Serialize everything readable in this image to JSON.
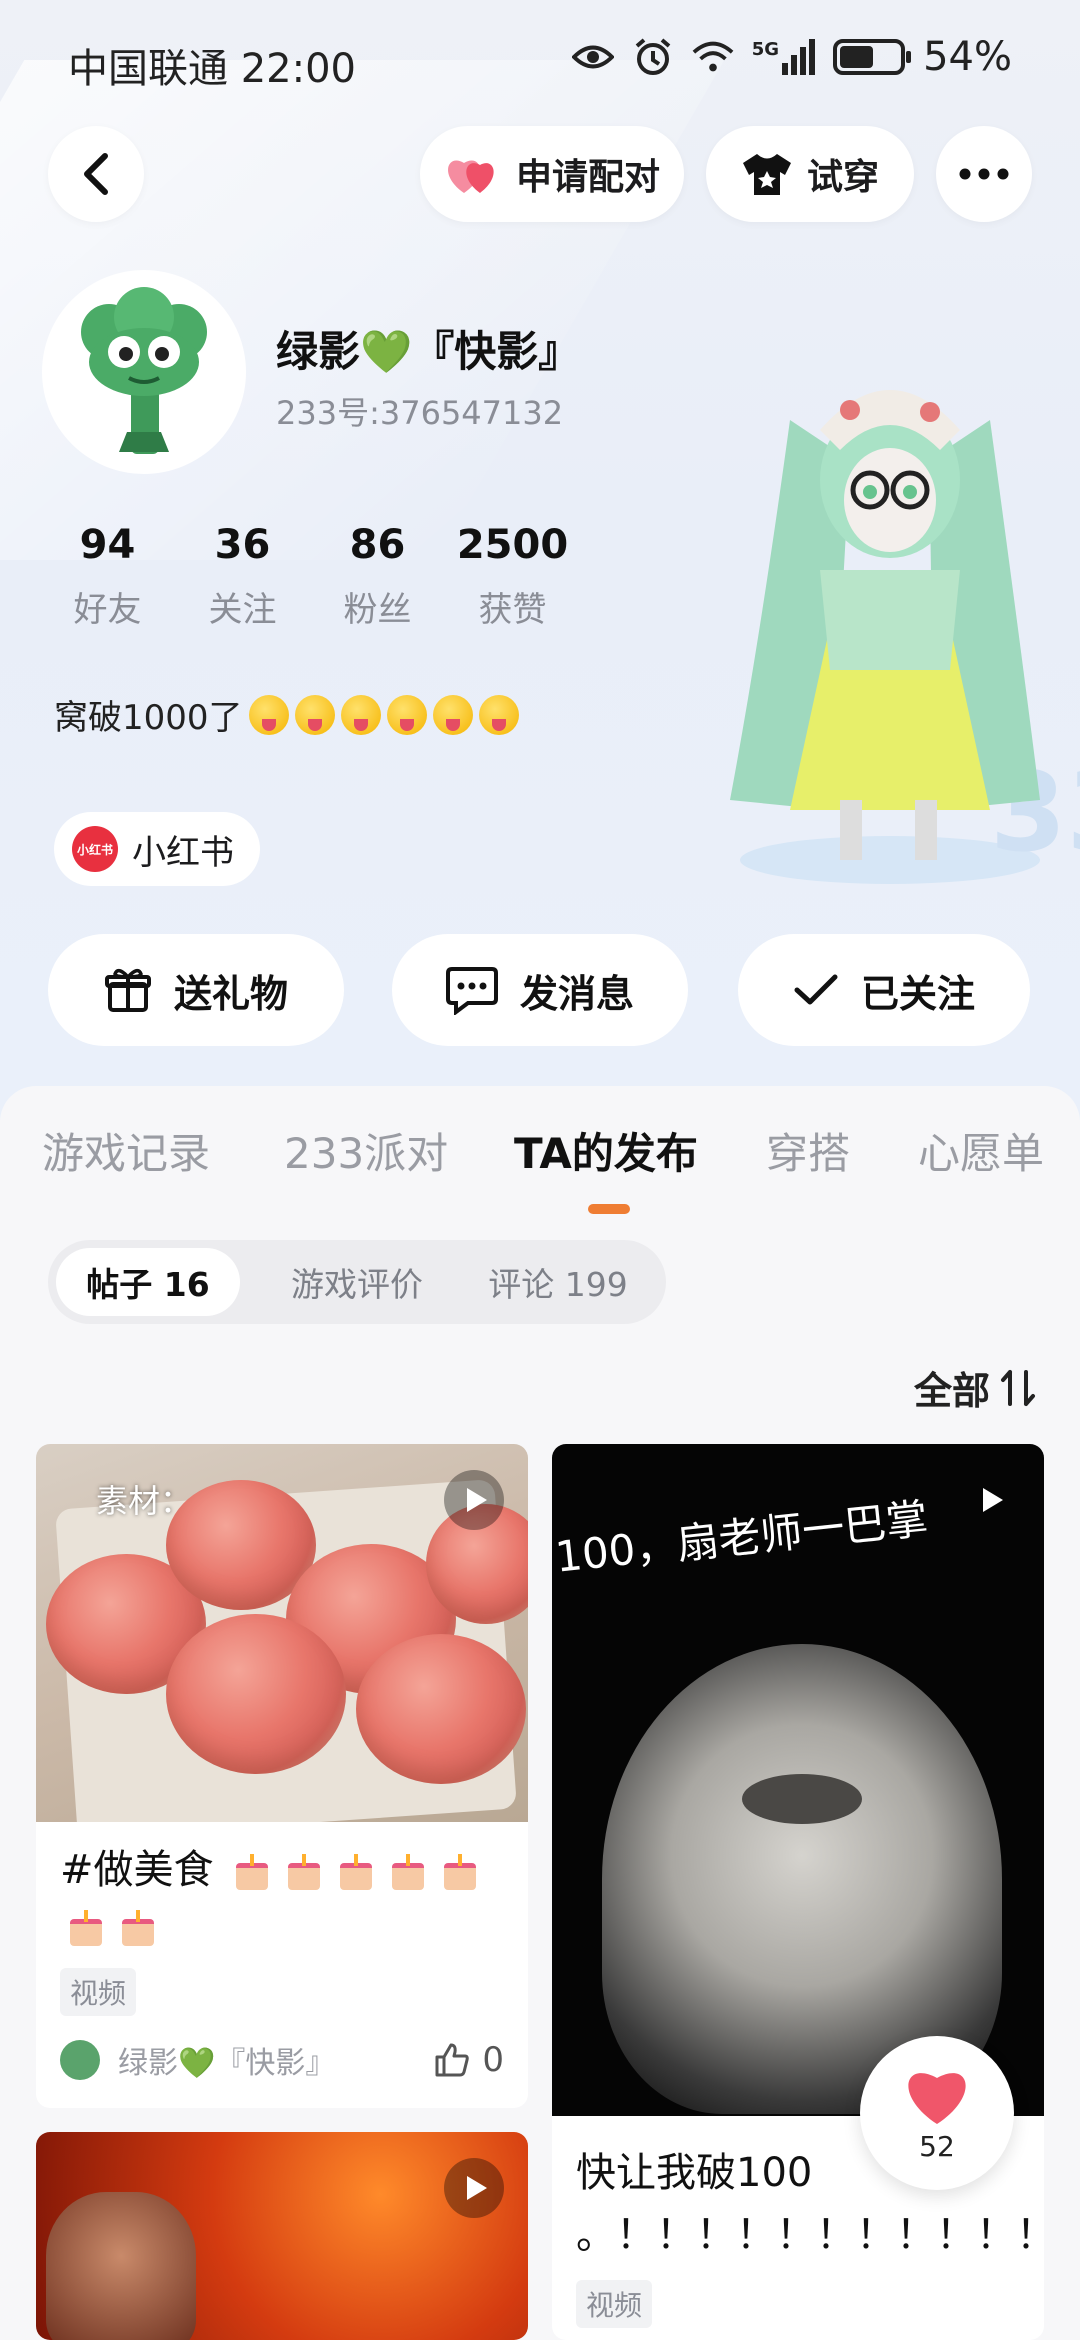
{
  "status_bar": {
    "carrier_time": "中国联通 22:00",
    "signal": "5G",
    "battery": "54%",
    "battery_level": 0.54
  },
  "top_nav": {
    "pair_label": "申请配对",
    "try_on_label": "试穿"
  },
  "profile": {
    "name": "绿影💚『快影』",
    "uid": "233号:376547132",
    "stats": [
      {
        "value": "94",
        "label": "好友"
      },
      {
        "value": "36",
        "label": "关注"
      },
      {
        "value": "86",
        "label": "粉丝"
      },
      {
        "value": "2500",
        "label": "获赞"
      }
    ],
    "bio": "窝破1000了",
    "social": {
      "logo_text": "小红书",
      "label": "小红书"
    }
  },
  "actions": {
    "gift": "送礼物",
    "message": "发消息",
    "followed": "已关注"
  },
  "tabs": [
    "游戏记录",
    "233派对",
    "TA的发布",
    "穿搭",
    "心愿单"
  ],
  "active_tab": "TA的发布",
  "segments": [
    "帖子 16",
    "游戏评价",
    "评论 199"
  ],
  "sort_label": "全部",
  "posts": [
    {
      "overlay_text": "素材：",
      "title": "#做美食",
      "tag": "视频",
      "author": "绿影💚『快影』",
      "likes": "0"
    },
    {
      "overlay_text": "100，扇老师一巴掌",
      "title_line1": "快让我破100",
      "title_line2": "。！！！！！！！！！！！",
      "tag": "视频"
    }
  ],
  "float_like": {
    "count": "52"
  },
  "colors": {
    "accent": "#ef7d33",
    "heart": "#f0566a",
    "xhs_red": "#e8303f"
  }
}
